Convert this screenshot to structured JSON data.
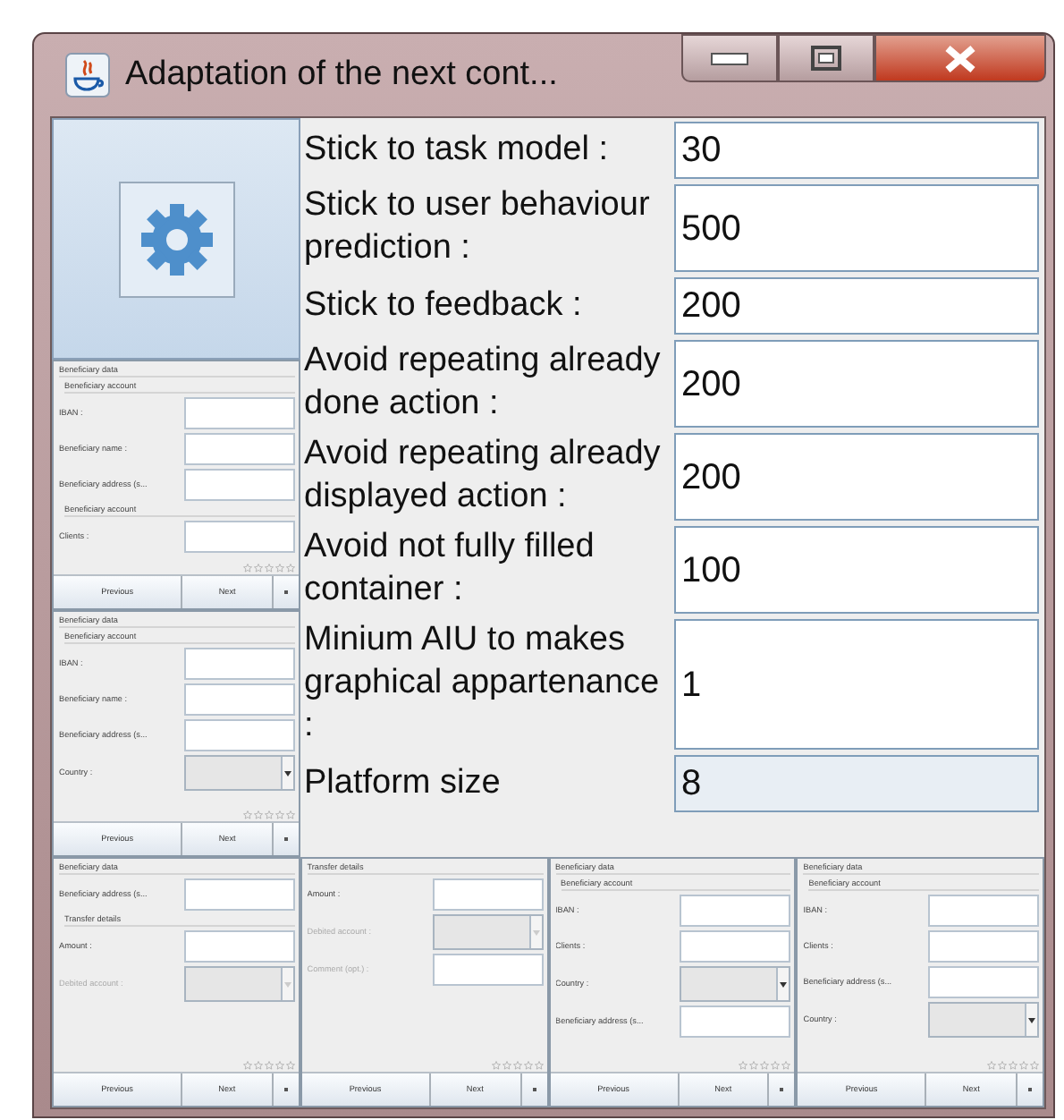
{
  "window": {
    "title": "Adaptation of the next cont..."
  },
  "criteria": [
    {
      "label": "Stick to task model :",
      "value": "30",
      "disabled": false
    },
    {
      "label": "Stick to user behaviour prediction :",
      "value": "500",
      "disabled": false
    },
    {
      "label": "Stick to feedback :",
      "value": "200",
      "disabled": false
    },
    {
      "label": "Avoid repeating already done action :",
      "value": "200",
      "disabled": false
    },
    {
      "label": "Avoid repeating already displayed action :",
      "value": "200",
      "disabled": false
    },
    {
      "label": "Avoid not fully filled container :",
      "value": "100",
      "disabled": false
    },
    {
      "label": "Minium AIU to makes graphical appartenance :",
      "value": "1",
      "disabled": false
    },
    {
      "label": "Platform size",
      "value": "8",
      "disabled": true
    }
  ],
  "previews": {
    "side": [
      {
        "items": [
          {
            "kind": "title",
            "text": "Beneficiary data"
          },
          {
            "kind": "group",
            "text": "Beneficiary account"
          },
          {
            "kind": "text",
            "label": "IBAN :",
            "disabled": false
          },
          {
            "kind": "text",
            "label": "Beneficiary name :",
            "disabled": false
          },
          {
            "kind": "text",
            "label": "Beneficiary address (s...",
            "disabled": false
          },
          {
            "kind": "group",
            "text": "Beneficiary account"
          },
          {
            "kind": "text",
            "label": "Clients :",
            "disabled": false
          }
        ],
        "stars": 0,
        "buttons": [
          "Previous",
          "Next"
        ]
      },
      {
        "items": [
          {
            "kind": "title",
            "text": "Beneficiary data"
          },
          {
            "kind": "group",
            "text": "Beneficiary account"
          },
          {
            "kind": "text",
            "label": "IBAN :",
            "disabled": false
          },
          {
            "kind": "text",
            "label": "Beneficiary name :",
            "disabled": false
          },
          {
            "kind": "text",
            "label": "Beneficiary address (s...",
            "disabled": false
          },
          {
            "kind": "combo",
            "label": "Country :",
            "disabled": false
          }
        ],
        "stars": 0,
        "buttons": [
          "Previous",
          "Next"
        ]
      }
    ],
    "bottom": [
      {
        "items": [
          {
            "kind": "title",
            "text": "Beneficiary data"
          },
          {
            "kind": "text",
            "label": "Beneficiary address (s...",
            "disabled": false
          },
          {
            "kind": "group",
            "text": "Transfer details"
          },
          {
            "kind": "text",
            "label": "Amount :",
            "disabled": false
          },
          {
            "kind": "combo",
            "label": "Debited account :",
            "disabled": true
          }
        ],
        "stars": 0,
        "buttons": [
          "Previous",
          "Next"
        ]
      },
      {
        "items": [
          {
            "kind": "title",
            "text": "Transfer details"
          },
          {
            "kind": "text",
            "label": "Amount :",
            "disabled": false
          },
          {
            "kind": "combo",
            "label": "Debited account :",
            "disabled": true
          },
          {
            "kind": "text",
            "label": "Comment (opt.) :",
            "disabled": true
          }
        ],
        "stars": 0,
        "buttons": [
          "Previous",
          "Next"
        ]
      },
      {
        "items": [
          {
            "kind": "title",
            "text": "Beneficiary data"
          },
          {
            "kind": "group",
            "text": "Beneficiary account"
          },
          {
            "kind": "text",
            "label": "IBAN :",
            "disabled": false
          },
          {
            "kind": "text",
            "label": "Clients :",
            "disabled": false
          },
          {
            "kind": "combo",
            "label": "Country :",
            "disabled": false
          },
          {
            "kind": "text",
            "label": "Beneficiary address (s...",
            "disabled": false
          }
        ],
        "stars": 0,
        "buttons": [
          "Previous",
          "Next"
        ]
      },
      {
        "items": [
          {
            "kind": "title",
            "text": "Beneficiary data"
          },
          {
            "kind": "group",
            "text": "Beneficiary account"
          },
          {
            "kind": "text",
            "label": "IBAN :",
            "disabled": false
          },
          {
            "kind": "text",
            "label": "Clients :",
            "disabled": false
          },
          {
            "kind": "text",
            "label": "Beneficiary address (s...",
            "disabled": false
          },
          {
            "kind": "combo",
            "label": "Country :",
            "disabled": false
          }
        ],
        "stars": 0,
        "buttons": [
          "Previous",
          "Next"
        ]
      }
    ]
  }
}
